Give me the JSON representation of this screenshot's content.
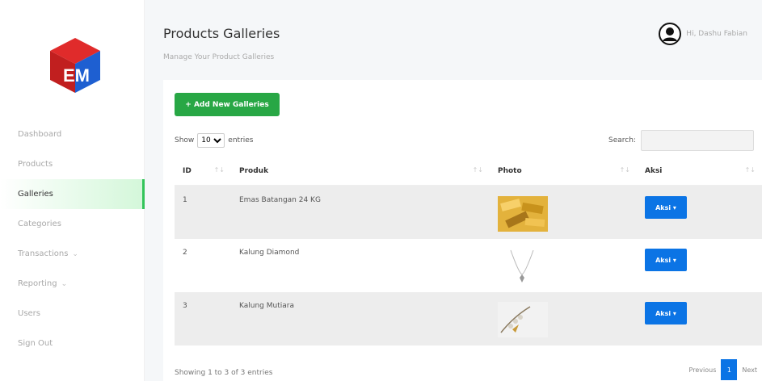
{
  "sidebar": {
    "logo_text": "EM",
    "items": [
      {
        "label": "Dashboard",
        "active": false,
        "chevron": false
      },
      {
        "label": "Products",
        "active": false,
        "chevron": false
      },
      {
        "label": "Galleries",
        "active": true,
        "chevron": false
      },
      {
        "label": "Categories",
        "active": false,
        "chevron": false
      },
      {
        "label": "Transactions",
        "active": false,
        "chevron": true
      },
      {
        "label": "Reporting",
        "active": false,
        "chevron": true
      },
      {
        "label": "Users",
        "active": false,
        "chevron": false
      },
      {
        "label": "Sign Out",
        "active": false,
        "chevron": false
      }
    ]
  },
  "header": {
    "title": "Products Galleries",
    "subtitle": "Manage Your Product Galleries",
    "user_label": "Hi, Dashu Fabian"
  },
  "toolbar": {
    "add_label": "+ Add New Galleries",
    "show_label": "Show",
    "entries_value": "10",
    "entries_label": "entries",
    "search_label": "Search:",
    "search_value": ""
  },
  "table": {
    "columns": [
      "ID",
      "Produk",
      "Photo",
      "Aksi"
    ],
    "rows": [
      {
        "id": "1",
        "produk": "Emas Batangan 24 KG",
        "photo": "gold-bars",
        "aksi": "Aksi"
      },
      {
        "id": "2",
        "produk": "Kalung Diamond",
        "photo": "diamond-necklace",
        "aksi": "Aksi"
      },
      {
        "id": "3",
        "produk": "Kalung Mutiara",
        "photo": "pearl-necklace",
        "aksi": "Aksi"
      }
    ]
  },
  "footer": {
    "info": "Showing 1 to 3 of 3 entries",
    "prev": "Previous",
    "page": "1",
    "next": "Next"
  },
  "colors": {
    "accent_green": "#28a745",
    "primary_blue": "#0b74e5",
    "active_nav": "#d4f7da"
  }
}
